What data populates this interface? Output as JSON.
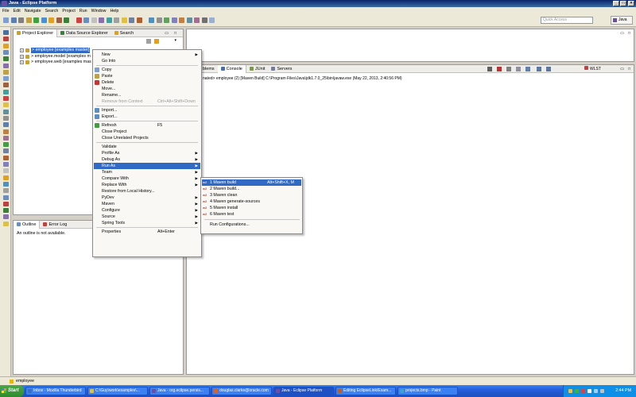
{
  "window": {
    "title": "Java - Eclipse Platform"
  },
  "menubar": [
    "File",
    "Edit",
    "Navigate",
    "Search",
    "Project",
    "Run",
    "Window",
    "Help"
  ],
  "toolbar": {
    "quick_access_placeholder": "Quick Access",
    "perspective_label": "Java"
  },
  "explorer": {
    "tabs": [
      "Project Explorer",
      "Data Source Explorer",
      "Search"
    ],
    "tree": [
      {
        "label": "> employee [examples master]",
        "selected": true
      },
      {
        "label": "> employee.model [examples m",
        "selected": false
      },
      {
        "label": "> employee.web [examples mas",
        "selected": false
      }
    ]
  },
  "outline": {
    "tabs": [
      "Outline",
      "Error Log"
    ],
    "message": "An outline is not available."
  },
  "console": {
    "tabs": [
      "blems",
      "Console",
      "JUnit",
      "Servers"
    ],
    "text": "nated> employee (2) [Maven Build] C:\\Program Files\\Java\\jdk1.7.0_25\\bin\\javaw.exe (May 22, 2013, 2:40:56 PM)",
    "toolbar_label": "WLST"
  },
  "context_menu": {
    "items": [
      {
        "label": "New",
        "submenu": true
      },
      {
        "label": "Go Into"
      },
      {
        "sep": true
      },
      {
        "label": "Copy",
        "icon": "copy-icon"
      },
      {
        "label": "Paste",
        "icon": "paste-icon"
      },
      {
        "label": "Delete",
        "icon": "delete-icon"
      },
      {
        "label": "Move..."
      },
      {
        "label": "Rename..."
      },
      {
        "label": "Remove from Context",
        "shortcut": "Ctrl+Alt+Shift+Down",
        "disabled": true
      },
      {
        "sep": true
      },
      {
        "label": "Import...",
        "icon": "import-icon"
      },
      {
        "label": "Export...",
        "icon": "export-icon"
      },
      {
        "sep": true
      },
      {
        "label": "Refresh",
        "shortcut": "F5",
        "icon": "refresh-icon"
      },
      {
        "label": "Close Project"
      },
      {
        "label": "Close Unrelated Projects"
      },
      {
        "sep": true
      },
      {
        "label": "Validate"
      },
      {
        "label": "Profile As",
        "submenu": true
      },
      {
        "label": "Debug As",
        "submenu": true
      },
      {
        "label": "Run As",
        "submenu": true,
        "highlighted": true
      },
      {
        "label": "Team",
        "submenu": true
      },
      {
        "label": "Compare With",
        "submenu": true
      },
      {
        "label": "Replace With",
        "submenu": true
      },
      {
        "label": "Restore from Local History..."
      },
      {
        "label": "PyDev",
        "submenu": true
      },
      {
        "label": "Maven",
        "submenu": true
      },
      {
        "label": "Configure",
        "submenu": true
      },
      {
        "label": "Source",
        "submenu": true
      },
      {
        "label": "Spring Tools",
        "submenu": true
      },
      {
        "sep": true
      },
      {
        "label": "Properties",
        "shortcut": "Alt+Enter"
      }
    ]
  },
  "run_as_submenu": {
    "items": [
      {
        "label": "1 Maven build",
        "shortcut": "Alt+Shift+X, M",
        "highlighted": true
      },
      {
        "label": "2 Maven build..."
      },
      {
        "label": "3 Maven clean"
      },
      {
        "label": "4 Maven generate-sources"
      },
      {
        "label": "5 Maven install"
      },
      {
        "label": "6 Maven test"
      },
      {
        "sep": true
      },
      {
        "label": "Run Configurations..."
      }
    ],
    "icon_text": "m2"
  },
  "statusbar": {
    "text": "employee"
  },
  "taskbar": {
    "start": "Start",
    "tasks": [
      {
        "label": "Inbox - Mozilla Thunderbird",
        "active": false
      },
      {
        "label": "C:\\Guy\\work\\examples\\...",
        "active": false
      },
      {
        "label": "Java - org.eclipse.persis...",
        "active": false
      },
      {
        "label": "douglas.clarke@oracle.com",
        "active": false
      },
      {
        "label": "Java - Eclipse Platform",
        "active": true
      },
      {
        "label": "Editing EclipseLink/Exam...",
        "active": false
      },
      {
        "label": "projects.bmp - Paint",
        "active": false
      }
    ],
    "clock": "2:44 PM"
  }
}
